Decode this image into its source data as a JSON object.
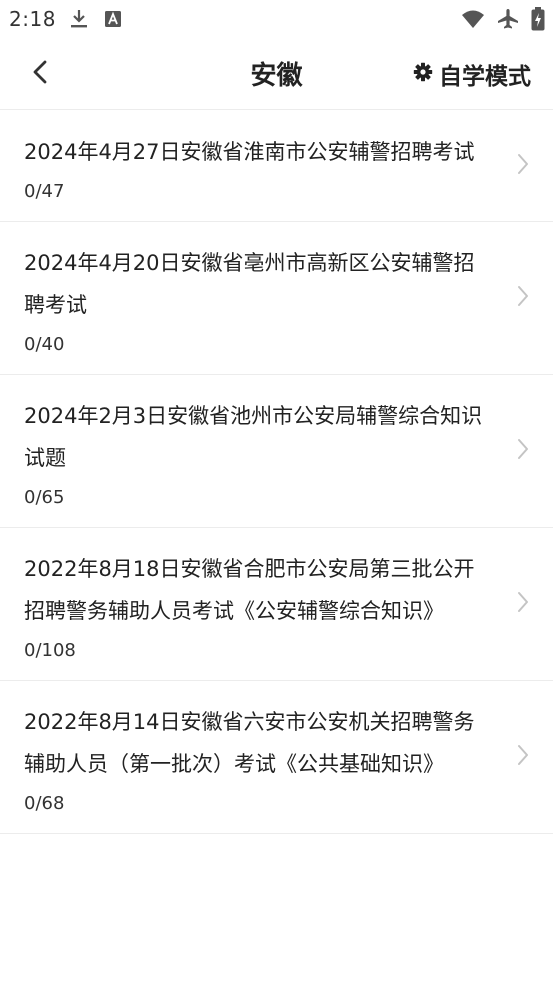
{
  "status_bar": {
    "time": "2:18",
    "icons": [
      "download-icon",
      "font-a-icon",
      "wifi-icon",
      "airplane-icon",
      "battery-charging-icon"
    ]
  },
  "header": {
    "title": "安徽",
    "mode_label": "自学模式",
    "back_icon": "chevron-left-icon",
    "mode_icon": "gear-icon"
  },
  "exams": [
    {
      "title": "2024年4月27日安徽省淮南市公安辅警招聘考试",
      "progress": "0/47"
    },
    {
      "title": "2024年4月20日安徽省亳州市高新区公安辅警招聘考试",
      "progress": "0/40"
    },
    {
      "title": "2024年2月3日安徽省池州市公安局辅警综合知识试题",
      "progress": "0/65"
    },
    {
      "title": "2022年8月18日安徽省合肥市公安局第三批公开招聘警务辅助人员考试《公安辅警综合知识》",
      "progress": "0/108"
    },
    {
      "title": "2022年8月14日安徽省六安市公安机关招聘警务辅助人员（第一批次）考试《公共基础知识》",
      "progress": "0/68"
    }
  ],
  "colors": {
    "text": "#222222",
    "divider": "#ececec",
    "chevron": "#c4c4c4"
  }
}
